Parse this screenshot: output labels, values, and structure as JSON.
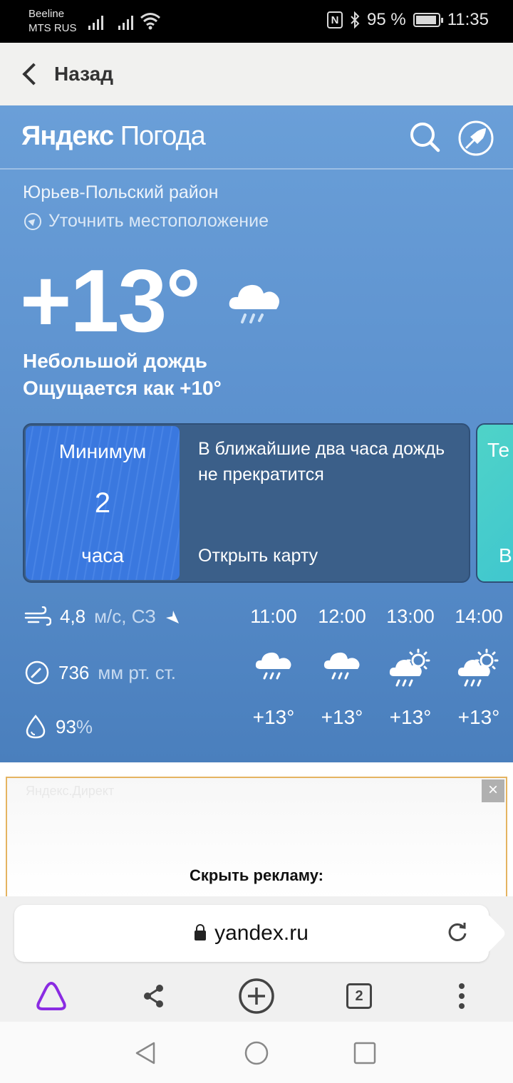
{
  "status_bar": {
    "carrier_1": "Beeline",
    "carrier_2": "MTS RUS",
    "battery": "95 %",
    "battery_level": 0.95,
    "time": "11:35"
  },
  "nav": {
    "back_label": "Назад"
  },
  "header": {
    "brand_bold": "Яндекс",
    "brand_light": "Погода",
    "search_icon": "search-icon",
    "rocket_icon": "rocket-icon"
  },
  "location": {
    "name": "Юрьев-Польский район",
    "refine": "Уточнить местоположение"
  },
  "current": {
    "temp": "+13°",
    "condition": "Небольшой дождь",
    "feels_like": "Ощущается как +10°"
  },
  "nowcast_card": {
    "title": "Минимум",
    "value": "2",
    "unit": "часа",
    "message": "В ближайшие два часа дождь не прекратится",
    "link": "Открыть карту"
  },
  "second_card": {
    "text_top": "Те",
    "text_bottom": "В"
  },
  "details": {
    "wind_value": "4,8",
    "wind_unit": "м/с, СЗ",
    "pressure_value": "736",
    "pressure_unit": "мм рт. ст.",
    "humidity_value": "93",
    "humidity_unit": "%"
  },
  "hourly": [
    {
      "time": "11:00",
      "icon": "rain-cloud",
      "temp": "+13°"
    },
    {
      "time": "12:00",
      "icon": "rain-cloud",
      "temp": "+13°"
    },
    {
      "time": "13:00",
      "icon": "sun-cloud-rain",
      "temp": "+13°"
    },
    {
      "time": "14:00",
      "icon": "sun-cloud-rain",
      "temp": "+13°"
    }
  ],
  "ad": {
    "label": "Яндекс.Директ",
    "close": "×",
    "hide_text": "Скрыть рекламу:"
  },
  "browser": {
    "url": "yandex.ru",
    "tabs_count": "2"
  },
  "colors": {
    "weather_bg": "#5d92cf",
    "card_bg": "#3b5f89",
    "rain_card": "#3a78df",
    "alice": "#8a2be2"
  }
}
